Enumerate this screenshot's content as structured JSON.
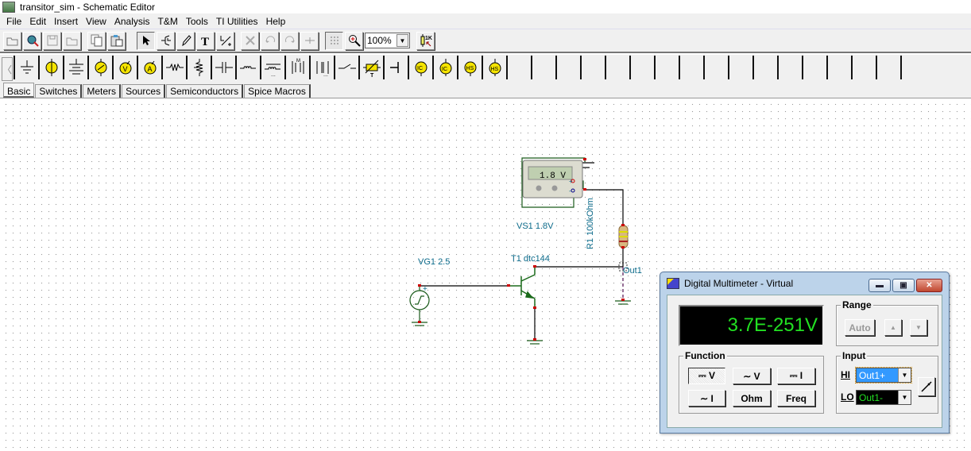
{
  "window": {
    "title": "transitor_sim - Schematic Editor"
  },
  "menu": [
    "File",
    "Edit",
    "Insert",
    "View",
    "Analysis",
    "T&M",
    "Tools",
    "TI Utilities",
    "Help"
  ],
  "toolbar": {
    "buttons": [
      {
        "name": "open-icon",
        "glyph": "📂"
      },
      {
        "name": "open-examples-icon",
        "glyph": "🔍"
      },
      {
        "name": "save-icon",
        "glyph": "💾"
      },
      {
        "name": "close-file-icon",
        "glyph": "📂"
      },
      {
        "name": "copy-icon",
        "glyph": "⎘"
      },
      {
        "name": "paste-icon",
        "glyph": "📋"
      }
    ],
    "tools": [
      {
        "name": "select-arrow-icon",
        "glyph": "↖",
        "active": true
      },
      {
        "name": "wire-icon",
        "glyph": "⊣"
      },
      {
        "name": "pencil-icon",
        "glyph": "✎"
      },
      {
        "name": "text-icon",
        "glyph": "T"
      },
      {
        "name": "rotate-component-icon",
        "glyph": "⟋"
      }
    ],
    "edit": [
      {
        "name": "delete-icon",
        "glyph": "✕"
      },
      {
        "name": "undo-icon",
        "glyph": "↶"
      },
      {
        "name": "redo-icon",
        "glyph": "↷"
      },
      {
        "name": "junction-icon",
        "glyph": "⊹"
      }
    ],
    "zoom_value": "100%",
    "grid_label": "⁞⁞⁞"
  },
  "parts": [
    "ground",
    "voltage-source",
    "battery",
    "signal-generator",
    "voltmeter",
    "ammeter",
    "resistor",
    "potentiometer",
    "capacitor",
    "inductor",
    "inductor-core",
    "transformer",
    "transformer-core",
    "switch",
    "thermistor",
    "plate",
    "current-source-ic",
    "current-source-ic-plus",
    "hs-source",
    "hs-source-plus"
  ],
  "empty_part_slots": 17,
  "tabs": [
    {
      "label": "Basic",
      "active": true
    },
    {
      "label": "Switches"
    },
    {
      "label": "Meters"
    },
    {
      "label": "Sources"
    },
    {
      "label": "Semiconductors"
    },
    {
      "label": "Spice Macros"
    }
  ],
  "schematic": {
    "labels": {
      "vs1": "VS1 1.8V",
      "vg1": "VG1 2.5",
      "t1": "T1 dtc144",
      "r1": "R1 100kOhm",
      "out1": "Out1",
      "meter_display": "1.8  V"
    }
  },
  "dmm": {
    "title": "Digital Multimeter - Virtual",
    "reading": "3.7E-251V",
    "range": {
      "legend": "Range",
      "auto_label": "Auto",
      "up_glyph": "▲",
      "down_glyph": "▼"
    },
    "function": {
      "legend": "Function",
      "buttons": [
        {
          "label": "⎓ V",
          "pressed": true
        },
        {
          "label": "∼ V"
        },
        {
          "label": "⎓ I"
        },
        {
          "label": "∼ I"
        },
        {
          "label": "Ohm"
        },
        {
          "label": "Freq"
        }
      ]
    },
    "input": {
      "legend": "Input",
      "hi_label": "HI",
      "hi_value": "Out1+",
      "lo_label": "LO",
      "lo_value": "Out1-"
    },
    "colors": {
      "display_text": "#22e022",
      "hi_bg": "#3399ff",
      "lo_text": "#22e022"
    }
  }
}
